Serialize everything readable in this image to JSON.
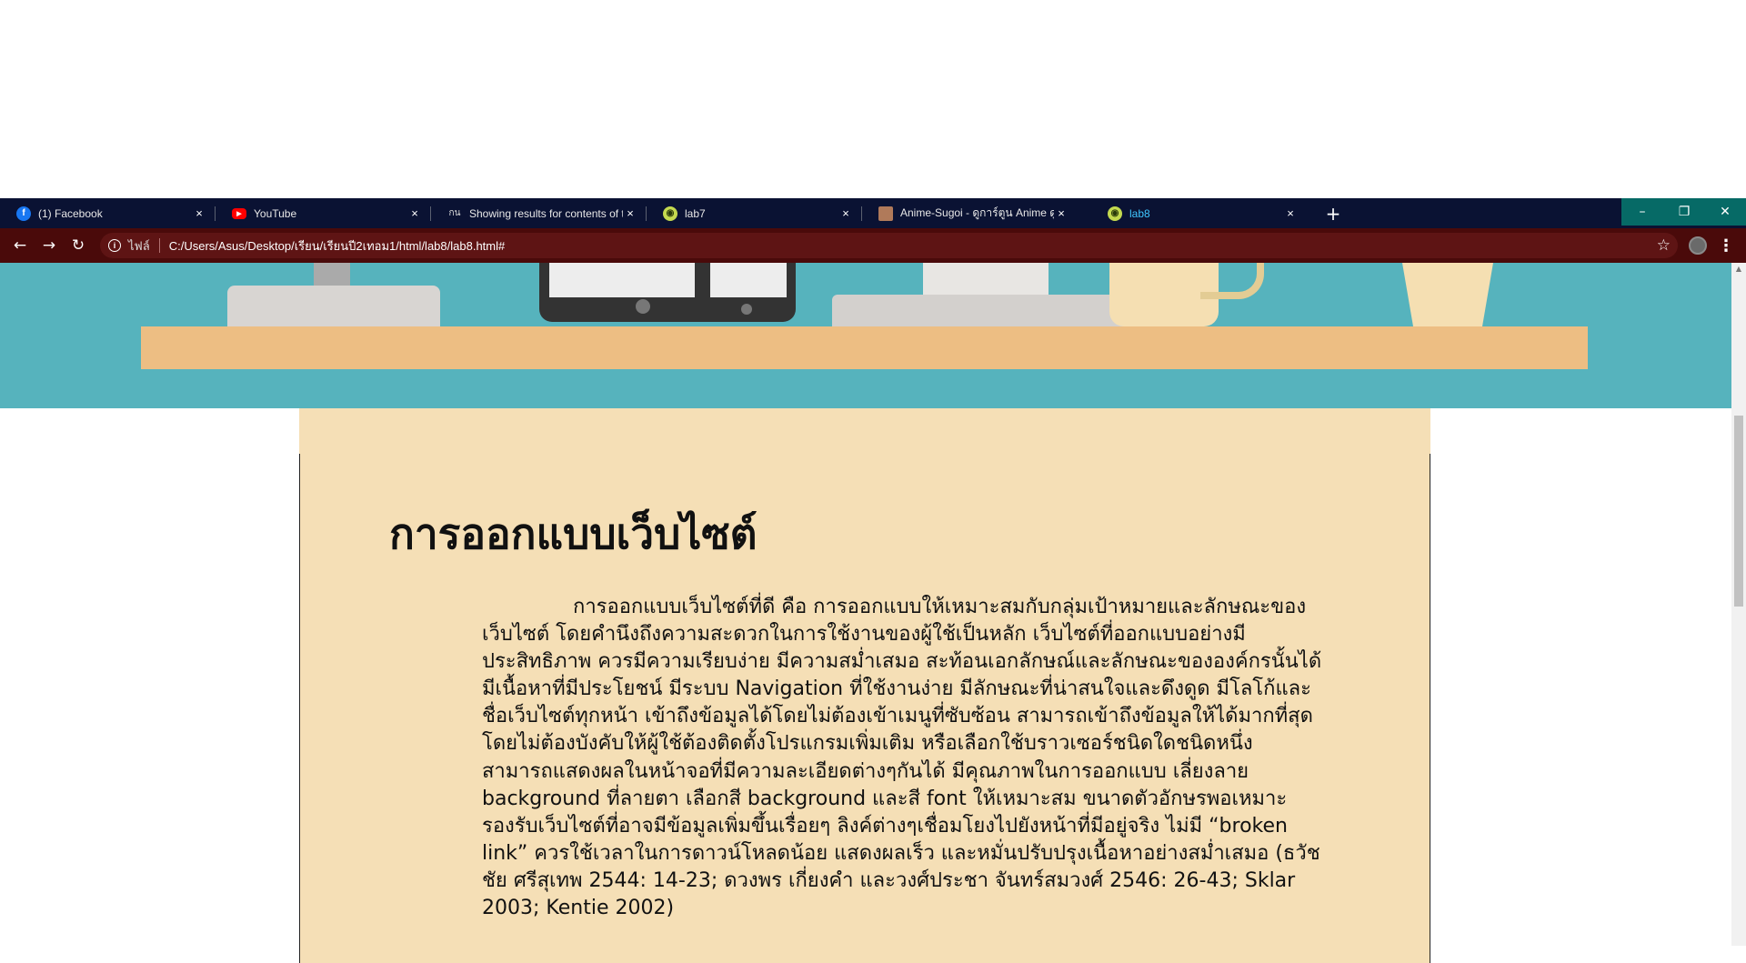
{
  "browser": {
    "tabs": [
      {
        "title": "(1) Facebook",
        "icon": "facebook-icon",
        "icon_color": "#1877f2",
        "active": false
      },
      {
        "title": "YouTube",
        "icon": "youtube-icon",
        "icon_color": "#ff0000",
        "active": false
      },
      {
        "title": "Showing results for contents of t",
        "icon_glyph": "กน",
        "icon": "site-icon",
        "active": false
      },
      {
        "title": "lab7",
        "icon": "globe-icon",
        "icon_color": "#c4d94f",
        "active": false
      },
      {
        "title": "Anime-Sugoi - ดูการ์ตูน Anime ดูก",
        "icon": "anime-icon",
        "active": false
      },
      {
        "title": "lab8",
        "icon": "globe-icon",
        "icon_color": "#c4d94f",
        "active": true
      }
    ],
    "close_glyph": "×",
    "new_tab_glyph": "+",
    "window_buttons": {
      "minimize": "–",
      "restore": "❐",
      "close": "✕"
    },
    "nav": {
      "back": "←",
      "forward": "→",
      "reload": "↻"
    },
    "omnibox": {
      "info_glyph": "i",
      "site_label": "ไฟล์",
      "url": "C:/Users/Asus/Desktop/เรียน/เรียนปี2เทอม1/html/lab8/lab8.html#"
    },
    "star_glyph": "☆",
    "menu_glyph": "⋮",
    "colors": {
      "tabstrip": "#0a1233",
      "toolbar": "#4a0a0a",
      "active_tab_text": "#3fc6ff",
      "window_buttons": "#066a66"
    }
  },
  "page": {
    "heading": "การออกแบบเว็บไซต์",
    "paragraph": "การออกแบบเว็บไซต์ที่ดี คือ การออกแบบให้เหมาะสมกับกลุ่มเป้าหมายและลักษณะของเว็บไซต์ โดยคำนึงถึงความสะดวกในการใช้งานของผู้ใช้เป็นหลัก เว็บไซต์ที่ออกแบบอย่างมีประสิทธิภาพ ควรมีความเรียบง่าย มีความสม่ำเสมอ สะท้อนเอกลักษณ์และลักษณะขององค์กรนั้นได้ มีเนื้อหาที่มีประโยชน์ มีระบบ Navigation ที่ใช้งานง่าย มีลักษณะที่น่าสนใจและดึงดูด มีโลโก้และชื่อเว็บไซต์ทุกหน้า เข้าถึงข้อมูลได้โดยไม่ต้องเข้าเมนูที่ซับซ้อน สามารถเข้าถึงข้อมูลให้ได้มากที่สุดโดยไม่ต้องบังคับให้ผู้ใช้ต้องติดตั้งโปรแกรมเพิ่มเติม หรือเลือกใช้บราวเซอร์ชนิดใดชนิดหนึ่ง สามารถแสดงผลในหน้าจอที่มีความละเอียดต่างๆกันได้ มีคุณภาพในการออกแบบ เลี่ยงลาย background ที่ลายตา เลือกสี background และสี font ให้เหมาะสม ขนาดตัวอักษรพอเหมาะ รองรับเว็บไซต์ที่อาจมีข้อมูลเพิ่มขึ้นเรื่อยๆ ลิงค์ต่างๆเชื่อมโยงไปยังหน้าที่มีอยู่จริง ไม่มี “broken link” ควรใช้เวลาในการดาวน์โหลดน้อย แสดงผลเร็ว และหมั่นปรับปรุงเนื้อหาอย่างสม่ำเสมอ (ธวัชชัย ศรีสุเทพ 2544: 14-23; ดวงพร เกี่ยงคำ และวงศ์ประชา จันทร์สมวงศ์ 2546: 26-43; Sklar 2003; Kentie 2002)",
    "colors": {
      "hero_bg": "#56b3bd",
      "shelf": "#edbe83",
      "content_bg": "#f5dfb6"
    }
  }
}
